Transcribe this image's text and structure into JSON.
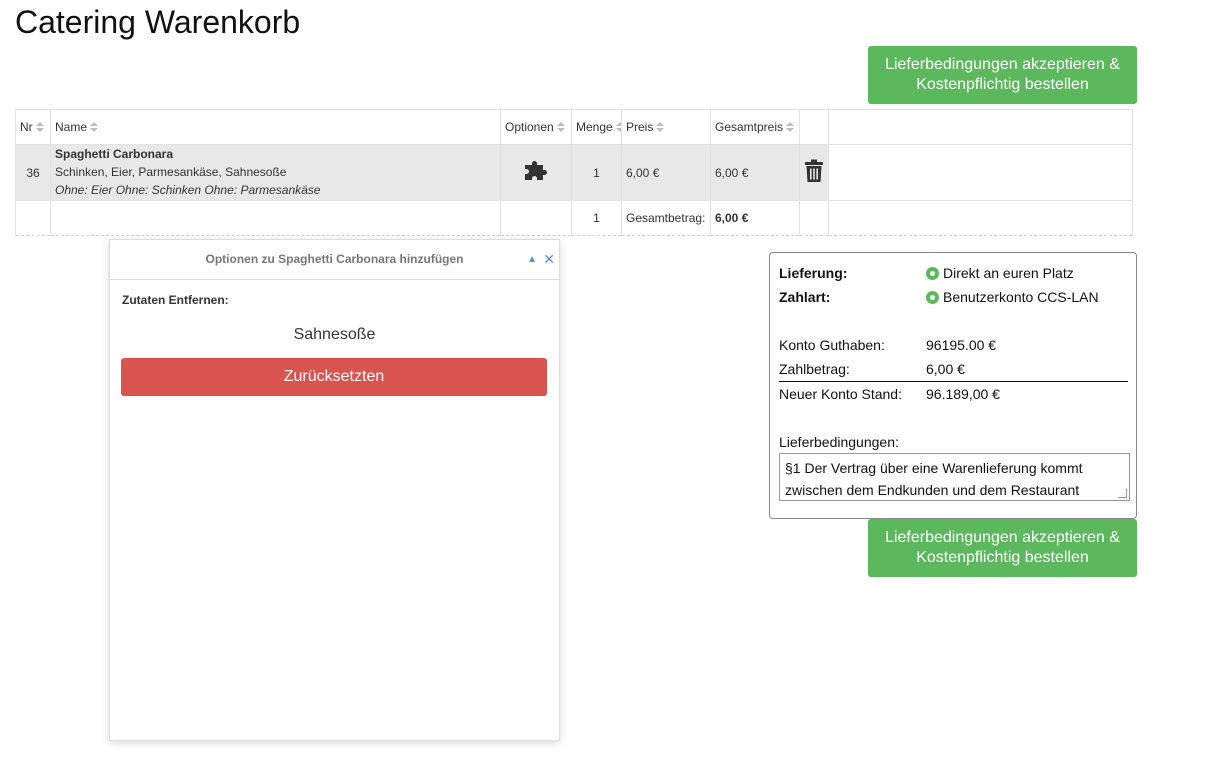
{
  "page": {
    "title": "Catering Warenkorb"
  },
  "order_button": {
    "line1": "Lieferbedingungen akzeptieren &",
    "line2": "Kostenpflichtig bestellen"
  },
  "table": {
    "headers": [
      "Nr",
      "Name",
      "Optionen",
      "Menge",
      "Preis",
      "Gesamtpreis"
    ],
    "rows": [
      {
        "nr": "36",
        "name": "Spaghetti Carbonara",
        "ingredients": "Schinken, Eier, Parmesankäse, Sahnesoße",
        "options": "Ohne: Eier Ohne: Schinken Ohne: Parmesankäse",
        "menge": "1",
        "preis": "6,00 €",
        "gesamtpreis": "6,00 €"
      }
    ],
    "summary": {
      "menge": "1",
      "label": "Gesamtbetrag:",
      "total": "6,00 €"
    }
  },
  "dialog": {
    "title": "Optionen zu Spaghetti Carbonara hinzufügen",
    "section": "Zutaten Entfernen:",
    "removed_item": "Sahnesoße",
    "reset_label": "Zurücksetzten"
  },
  "summary": {
    "lieferung_label": "Lieferung:",
    "lieferung_value": "Direkt an euren Platz",
    "zahlart_label": "Zahlart:",
    "zahlart_value": "Benutzerkonto CCS-LAN",
    "guthaben_label": "Konto Guthaben:",
    "guthaben_value": "96195.00 €",
    "zahlbetrag_label": "Zahlbetrag:",
    "zahlbetrag_value": "6,00 €",
    "neuer_label": "Neuer Konto Stand:",
    "neuer_value": "96.189,00 €",
    "terms_label": "Lieferbedingungen:",
    "terms_text": "§1 Der Vertrag über eine Warenlieferung kommt zwischen dem Endkunden und dem Restaurant"
  },
  "colors": {
    "primary_button": "#5cb85c",
    "danger_button": "#d9534f",
    "row_highlight": "#e8e8e8"
  },
  "icons": {
    "options": "puzzle-icon",
    "delete": "trash-icon",
    "dialog_collapse": "caret-up-icon",
    "dialog_close": "close-icon"
  }
}
